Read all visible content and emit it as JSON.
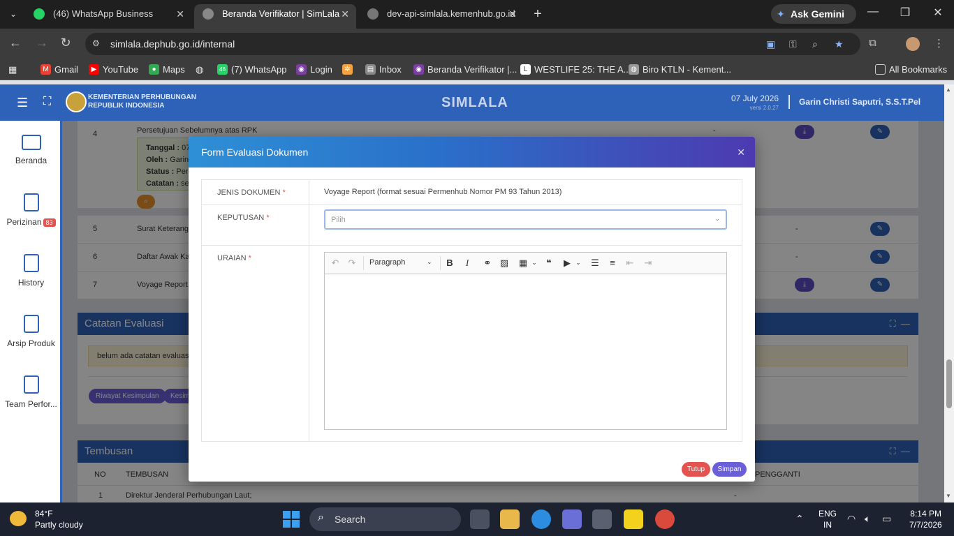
{
  "browser": {
    "tabs": [
      {
        "title": "(46) WhatsApp Business",
        "favicon_text": "46"
      },
      {
        "title": "Beranda Verifikator | SimLala",
        "active": true
      },
      {
        "title": "dev-api-simlala.kemenhub.go.id"
      }
    ],
    "gemini_label": "Ask Gemini",
    "url": "simlala.dephub.go.id/internal",
    "bookmarks": [
      "Gmail",
      "YouTube",
      "Maps",
      "(7) WhatsApp",
      "Login",
      "Inbox",
      "Beranda Verifikator |...",
      "WESTLIFE 25: THE A...",
      "Biro KTLN - Kement..."
    ],
    "bookmarks_badge": "46",
    "all_bookmarks": "All Bookmarks"
  },
  "app": {
    "org_line1": "KEMENTERIAN PERHUBUNGAN",
    "org_line2": "REPUBLIK INDONESIA",
    "brand": "SIMLALA",
    "date": "07 July 2026",
    "version": "versi 2.0.27",
    "user": "Garin Christi Saputri, S.S.T.Pel"
  },
  "sidebar": {
    "items": [
      {
        "label": "Beranda"
      },
      {
        "label": "Perizinan",
        "badge": "83"
      },
      {
        "label": "History"
      },
      {
        "label": "Arsip Produk"
      },
      {
        "label": "Team Perfor..."
      }
    ]
  },
  "background": {
    "rows": [
      {
        "no": "4",
        "name": "Persetujuan Sebelumnya atas RPK"
      },
      {
        "no": "5",
        "name": "Surat Keterangan"
      },
      {
        "no": "6",
        "name": "Daftar Awak Kap"
      },
      {
        "no": "7",
        "name": "Voyage Report ("
      }
    ],
    "info_labels": {
      "tanggal": "Tanggal :",
      "tanggal_val": "07",
      "oleh": "Oleh :",
      "oleh_val": "Garin",
      "status": "Status :",
      "status_val": "Pers",
      "catatan": "Catatan :",
      "catatan_val": "ses"
    },
    "dash": "-",
    "catatan_title": "Catatan Evaluasi",
    "catatan_empty": "belum ada catatan evaluasi",
    "riwayat_btn": "Riwayat Kesimpulan",
    "kesim_btn": "Kesim",
    "tembusan_title": "Tembusan",
    "tembusan_headers": [
      "NO",
      "TEMBUSAN",
      "PENGGANTI"
    ],
    "tembusan_row": {
      "no": "1",
      "name": "Direktur Jenderal Perhubungan Laut;",
      "pengganti": "-"
    }
  },
  "modal": {
    "title": "Form Evaluasi Dokumen",
    "jenis_label": "JENIS DOKUMEN",
    "jenis_value": "Voyage Report (format sesuai Permenhub Nomor PM 93 Tahun 2013)",
    "keputusan_label": "KEPUTUSAN",
    "keputusan_placeholder": "Pilih",
    "uraian_label": "URAIAN",
    "editor_paragraph": "Paragraph",
    "required_mark": "*",
    "btn_tutup": "Tutup",
    "btn_simpan": "Simpan"
  },
  "taskbar": {
    "temp": "84°F",
    "condition": "Partly cloudy",
    "search": "Search",
    "lang1": "ENG",
    "lang2": "IN",
    "time": "8:14 PM",
    "date": "7/7/2026"
  }
}
